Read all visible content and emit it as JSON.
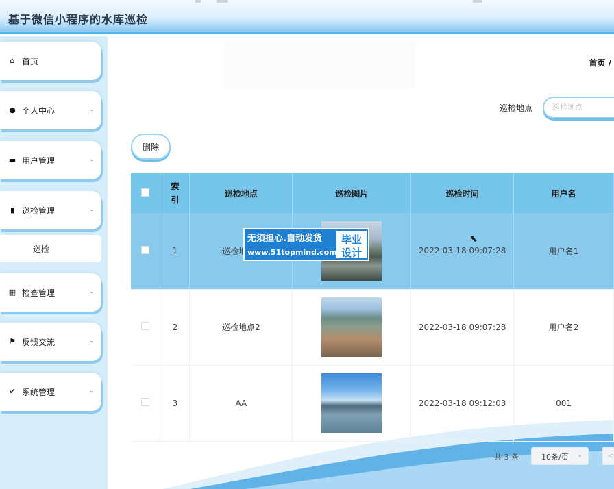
{
  "app": {
    "title": "基于微信小程序的水库巡检"
  },
  "sidebar": {
    "items": [
      {
        "label": "首页",
        "icon": "home-icon",
        "has_chevron": false
      },
      {
        "label": "个人中心",
        "icon": "user-icon",
        "has_chevron": true
      },
      {
        "label": "用户管理",
        "icon": "monitor-icon",
        "has_chevron": true
      },
      {
        "label": "巡检管理",
        "icon": "book-icon",
        "has_chevron": true
      },
      {
        "label": "检查管理",
        "icon": "grid-icon",
        "has_chevron": true
      },
      {
        "label": "反馈交流",
        "icon": "flag-icon",
        "has_chevron": true
      },
      {
        "label": "系统管理",
        "icon": "clipboard-check-icon",
        "has_chevron": true
      }
    ],
    "submenu": {
      "label": "巡检"
    }
  },
  "breadcrumb": {
    "current": "首页 /"
  },
  "search": {
    "label": "巡检地点",
    "placeholder": "巡检地点"
  },
  "toolbar": {
    "delete_label": "删除"
  },
  "table": {
    "columns": [
      "索引",
      "巡检地点",
      "巡检图片",
      "巡检时间",
      "用户名"
    ],
    "rows": [
      {
        "index": "1",
        "location": "巡检地点1",
        "image": "reservoir-photo-1",
        "time": "2022-03-18 09:07:28",
        "username": "用户名1",
        "selected": true
      },
      {
        "index": "2",
        "location": "巡检地点2",
        "image": "reservoir-photo-2",
        "time": "2022-03-18 09:07:28",
        "username": "用户名2",
        "selected": false
      },
      {
        "index": "3",
        "location": "AA",
        "image": "reservoir-photo-3",
        "time": "2022-03-18 09:12:03",
        "username": "001",
        "selected": false
      }
    ]
  },
  "pager": {
    "total": "共 3 条",
    "page_size": "10条/页",
    "prev": "<"
  },
  "watermark": {
    "line1": "无须担心.自动发货",
    "line2": "www.51topmind.com",
    "badge_line1": "毕业",
    "badge_line2": "设计"
  },
  "colors": {
    "accent": "#75c4ea",
    "selected_row": "#88c9ec",
    "sidebar_bg": "#d6eefa"
  }
}
